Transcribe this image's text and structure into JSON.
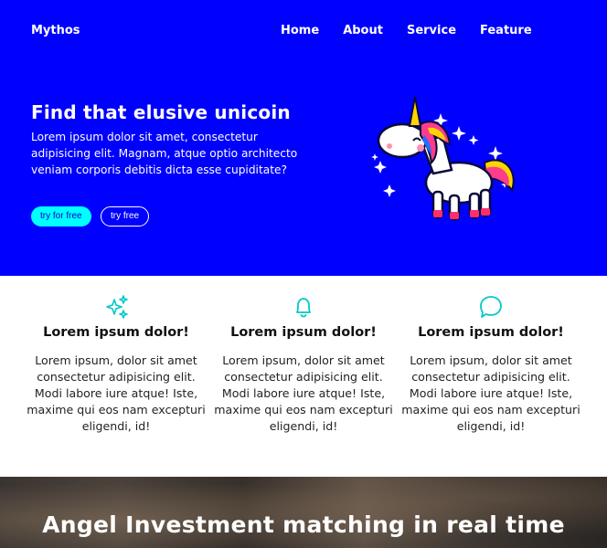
{
  "brand": "Mythos",
  "nav": [
    "Home",
    "About",
    "Service",
    "Feature"
  ],
  "hero": {
    "title": "Find that elusive unicoin",
    "text": "Lorem ipsum dolor sit amet, consectetur adipisicing elit. Magnam, atque optio architecto veniam corporis debitis dicta esse cupiditate?",
    "primary_button": "try for free",
    "secondary_button": "try free",
    "image": "unicorn-illustration"
  },
  "features": [
    {
      "icon": "sparkles-icon",
      "title": "Lorem ipsum dolor!",
      "text": "Lorem ipsum, dolor sit amet consectetur adipisicing elit. Modi labore iure atque! Iste, maxime qui eos nam excepturi eligendi, id!"
    },
    {
      "icon": "bell-icon",
      "title": "Lorem ipsum dolor!",
      "text": "Lorem ipsum, dolor sit amet consectetur adipisicing elit. Modi labore iure atque! Iste, maxime qui eos nam excepturi eligendi, id!"
    },
    {
      "icon": "chat-icon",
      "title": "Lorem ipsum dolor!",
      "text": "Lorem ipsum, dolor sit amet consectetur adipisicing elit. Modi labore iure atque! Iste, maxime qui eos nam excepturi eligendi, id!"
    }
  ],
  "banner": {
    "title": "Angel Investment matching in real time"
  },
  "colors": {
    "hero_bg": "#0000ff",
    "accent": "#00ffff",
    "icon": "#00c8c8"
  }
}
